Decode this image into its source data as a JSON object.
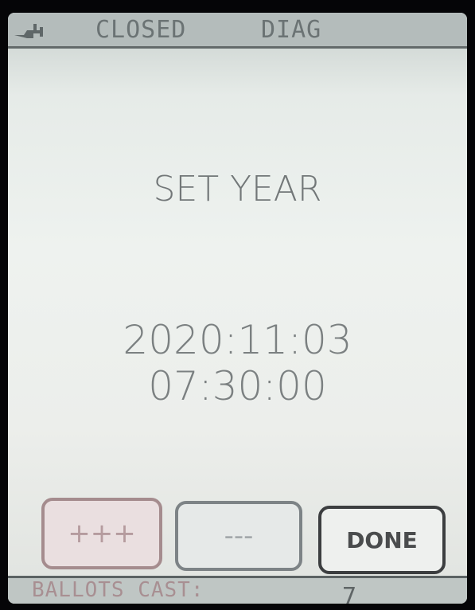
{
  "status_bar": {
    "icon": "plug-icon",
    "state": "CLOSED",
    "mode": "DIAG"
  },
  "main": {
    "title": "SET YEAR",
    "date": "2020:11:03",
    "time": "07:30:00"
  },
  "buttons": {
    "increment_label": "+++",
    "decrement_label": "---",
    "done_label": "DONE"
  },
  "footer": {
    "ballots_cast_label": "BALLOTS CAST:",
    "ballots_cast_value": "7"
  },
  "colors": {
    "screen_background": "#e8ecea",
    "status_bar": "#b4bcbb",
    "text": "#727778",
    "increment_button_tint": "#a58c8e",
    "done_border": "#3c3e40"
  }
}
